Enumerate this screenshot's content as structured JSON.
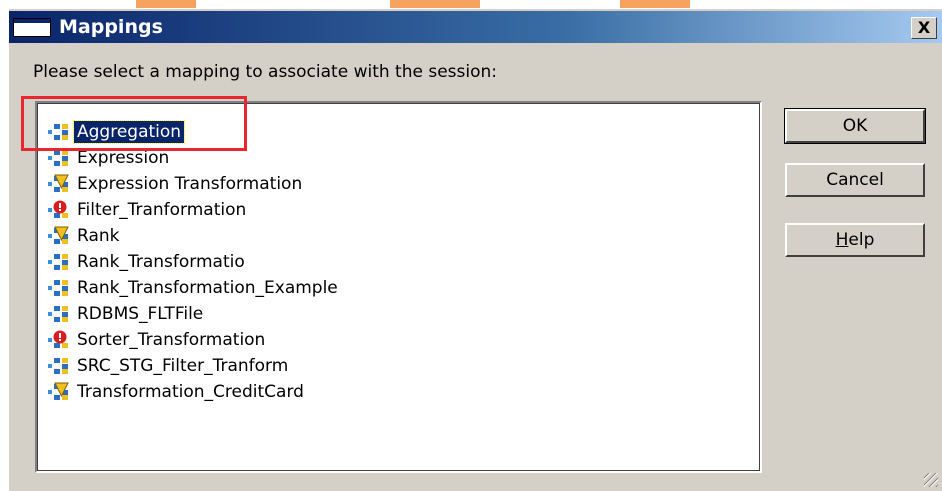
{
  "window": {
    "title": "Mappings",
    "close_label": "X"
  },
  "prompt": "Please select a mapping to associate with the session:",
  "mappings": [
    {
      "label": "Aggregation",
      "icon": "mapping-valid-icon",
      "selected": true
    },
    {
      "label": "Expression",
      "icon": "mapping-valid-icon"
    },
    {
      "label": "Expression Transformation",
      "icon": "mapping-warning-icon"
    },
    {
      "label": "Filter_Tranformation",
      "icon": "mapping-invalid-icon"
    },
    {
      "label": "Rank",
      "icon": "mapping-warning-icon"
    },
    {
      "label": "Rank_Transformatio",
      "icon": "mapping-valid-icon"
    },
    {
      "label": "Rank_Transformation_Example",
      "icon": "mapping-valid-icon"
    },
    {
      "label": "RDBMS_FLTFile",
      "icon": "mapping-valid-icon"
    },
    {
      "label": "Sorter_Transformation",
      "icon": "mapping-invalid-icon"
    },
    {
      "label": "SRC_STG_Filter_Tranform",
      "icon": "mapping-valid-icon"
    },
    {
      "label": "Transformation_CreditCard",
      "icon": "mapping-warning-icon"
    }
  ],
  "buttons": {
    "ok": "OK",
    "cancel": "Cancel",
    "help_mnemonic": "H",
    "help_rest": "elp"
  },
  "colors": {
    "selection": "#0a246a",
    "highlight_box": "#e8262f",
    "dialog_face": "#d4d0c8"
  }
}
